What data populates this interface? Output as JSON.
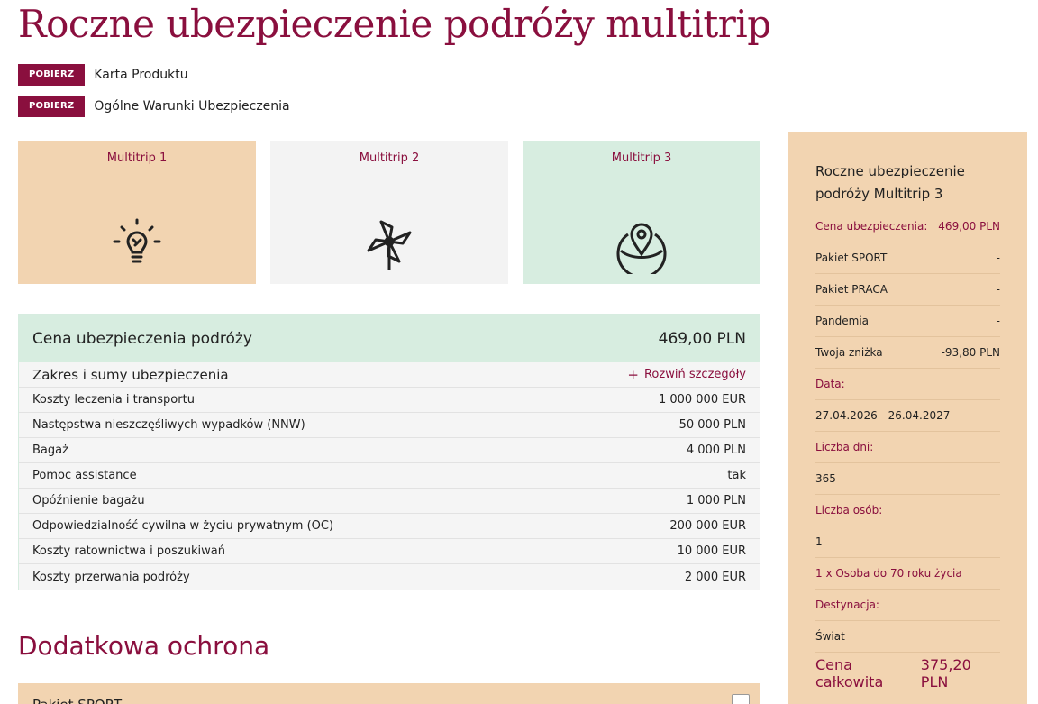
{
  "page": {
    "title": "Roczne ubezpieczenie podróży multitrip"
  },
  "downloads": [
    {
      "badge": "POBIERZ",
      "label": "Karta Produktu"
    },
    {
      "badge": "POBIERZ",
      "label": "Ogólne Warunki Ubezpieczenia"
    }
  ],
  "plans": [
    {
      "name": "Multitrip 1",
      "icon": "lightbulb-icon",
      "color": "#f2d4b1"
    },
    {
      "name": "Multitrip 2",
      "icon": "pinwheel-icon",
      "color": "#f3f3f3"
    },
    {
      "name": "Multitrip 3",
      "icon": "globe-pin-icon",
      "color": "#d7ede0"
    }
  ],
  "price": {
    "label": "Cena ubezpieczenia podróży",
    "value": "469,00 PLN",
    "scope_label": "Zakres i sumy ubezpieczenia",
    "expand_label": "Rozwiń szczegóły",
    "coverage": [
      {
        "name": "Koszty leczenia i transportu",
        "value": "1 000 000 EUR"
      },
      {
        "name": "Następstwa nieszczęśliwych wypadków (NNW)",
        "value": "50 000 PLN"
      },
      {
        "name": "Bagaż",
        "value": "4 000 PLN"
      },
      {
        "name": "Pomoc assistance",
        "value": "tak"
      },
      {
        "name": "Opóźnienie bagażu",
        "value": "1 000 PLN"
      },
      {
        "name": "Odpowiedzialność cywilna w życiu prywatnym (OC)",
        "value": "200 000 EUR"
      },
      {
        "name": "Koszty ratownictwa i poszukiwań",
        "value": "10 000 EUR"
      },
      {
        "name": "Koszty przerwania podróży",
        "value": "2 000 EUR"
      }
    ]
  },
  "additional": {
    "title": "Dodatkowa ochrona",
    "sport_label": "Pakiet SPORT"
  },
  "summary": {
    "title": "Roczne ubezpieczenie podróży Multitrip 3",
    "rows": [
      {
        "label": "Cena ubezpieczenia:",
        "value": "469,00 PLN"
      },
      {
        "label": "Pakiet SPORT",
        "value": "-"
      },
      {
        "label": "Pakiet PRACA",
        "value": "-"
      },
      {
        "label": "Pandemia",
        "value": "-"
      },
      {
        "label": "Twoja zniżka",
        "value": "-93,80 PLN"
      },
      {
        "label": "Data:",
        "value": ""
      },
      {
        "label": "27.04.2026 - 26.04.2027",
        "value": ""
      },
      {
        "label": "Liczba dni:",
        "value": ""
      },
      {
        "label": "365",
        "value": ""
      },
      {
        "label": "Liczba osób:",
        "value": ""
      },
      {
        "label": "1",
        "value": ""
      },
      {
        "label": "1 x Osoba do 70 roku życia",
        "value": ""
      },
      {
        "label": "Destynacja:",
        "value": ""
      },
      {
        "label": "Świat",
        "value": ""
      }
    ],
    "total_label": "Cena całkowita",
    "total_value": "375,20 PLN"
  },
  "colors": {
    "brand": "#8a0f3e",
    "peach": "#f2d4b1",
    "mint": "#d7ede0",
    "gray": "#f3f3f3"
  }
}
